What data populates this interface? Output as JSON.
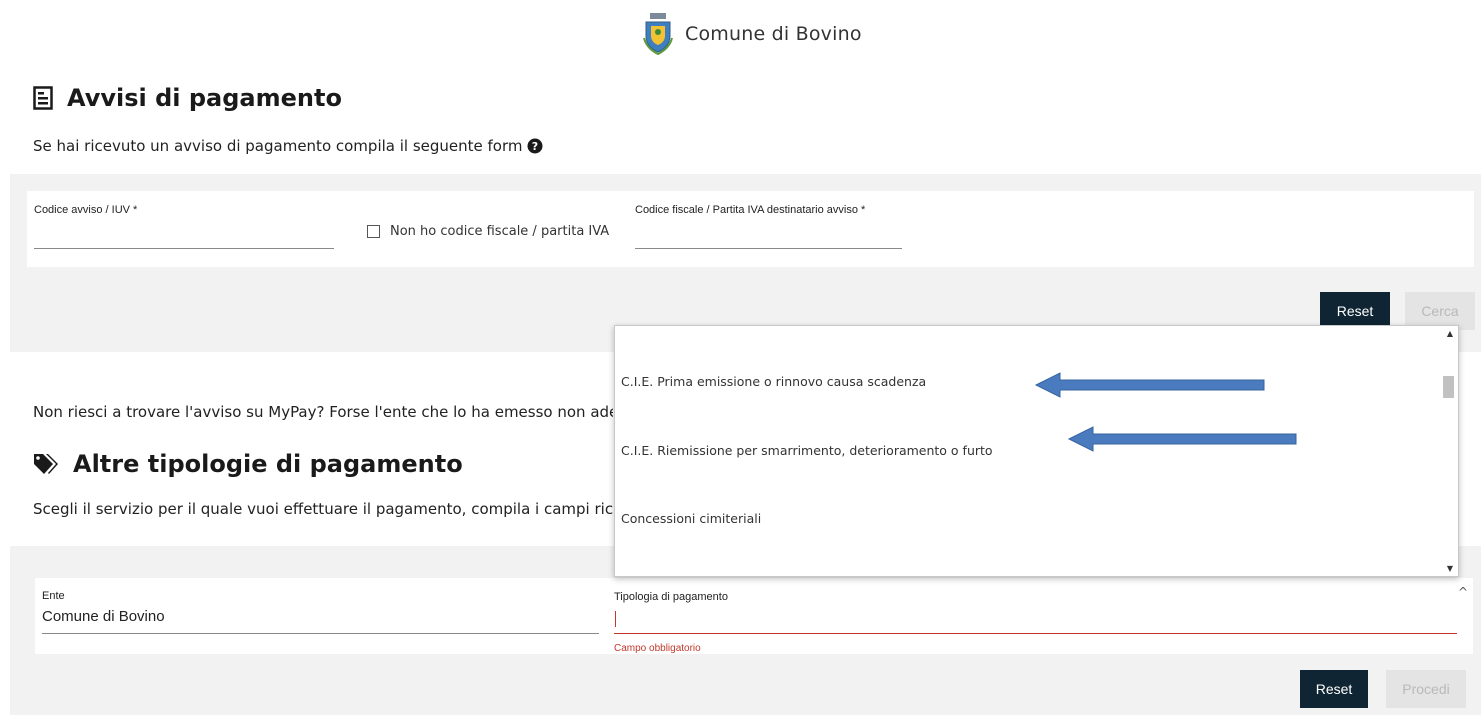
{
  "header": {
    "entity_name": "Comune di Bovino",
    "logo_icon": "coat-of-arms-icon"
  },
  "avvisi": {
    "title": "Avvisi di pagamento",
    "title_icon": "document-icon",
    "description": "Se hai ricevuto un avviso di pagamento compila il seguente form",
    "help_icon": "question-circle-icon",
    "iuv_label": "Codice avviso / IUV *",
    "iuv_value": "",
    "no_cf_label": "Non ho codice fiscale / partita IVA",
    "no_cf_checked": false,
    "cf_label": "Codice fiscale / Partita IVA destinatario avviso *",
    "cf_value": "",
    "reset_label": "Reset",
    "search_label": "Cerca"
  },
  "not_found_text": "Non riesci a trovare l'avviso su MyPay? Forse l'ente che lo ha emesso non aderis",
  "altre": {
    "title": "Altre tipologie di pagamento",
    "title_icon": "tags-icon",
    "description": "Scegli il servizio per il quale vuoi effettuare il pagamento, compila i campi richies",
    "ente_label": "Ente",
    "ente_value": "Comune di Bovino",
    "tipologia_label": "Tipologia di pagamento",
    "tipologia_value": "",
    "error_text": "Campo obbligatorio",
    "reset_label": "Reset",
    "proceed_label": "Procedi"
  },
  "dropdown": {
    "options": [
      "C.I.E. Prima emissione o rinnovo causa scadenza",
      "C.I.E. Riemissione per smarrimento, deterioramento o furto",
      "Concessioni cimiteriali"
    ]
  },
  "colors": {
    "dark_button": "#0f2533",
    "error": "#c0392b",
    "arrow": "#4a7bbf",
    "panel": "#f2f2f2"
  }
}
